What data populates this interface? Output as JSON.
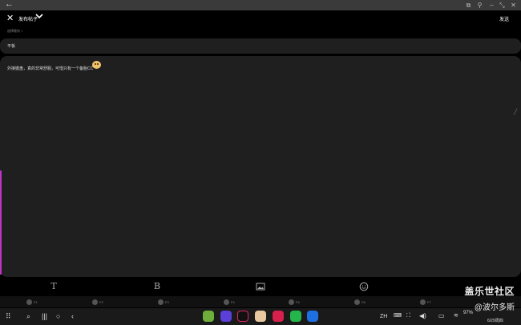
{
  "window": {
    "back_icon": "arrow-left-icon"
  },
  "header": {
    "forum_name": "发布帖子",
    "publish_label": "发送",
    "select_board_hint": "选择版块 >"
  },
  "post": {
    "title": "平板",
    "content": "外接键盘，真的非常舒服，可惜只有一个备胎CC"
  },
  "toolbar": {
    "text_icon": "T",
    "bold_icon": "B"
  },
  "fkeys": [
    "F1",
    "F2",
    "F3",
    "F4",
    "F5",
    "F6",
    "F7"
  ],
  "taskbar": {
    "lang": "ZH",
    "battery": "97%",
    "date": "6/29周四"
  },
  "watermark": {
    "line1": "盖乐世社区",
    "line2": "@波尔多斯"
  }
}
